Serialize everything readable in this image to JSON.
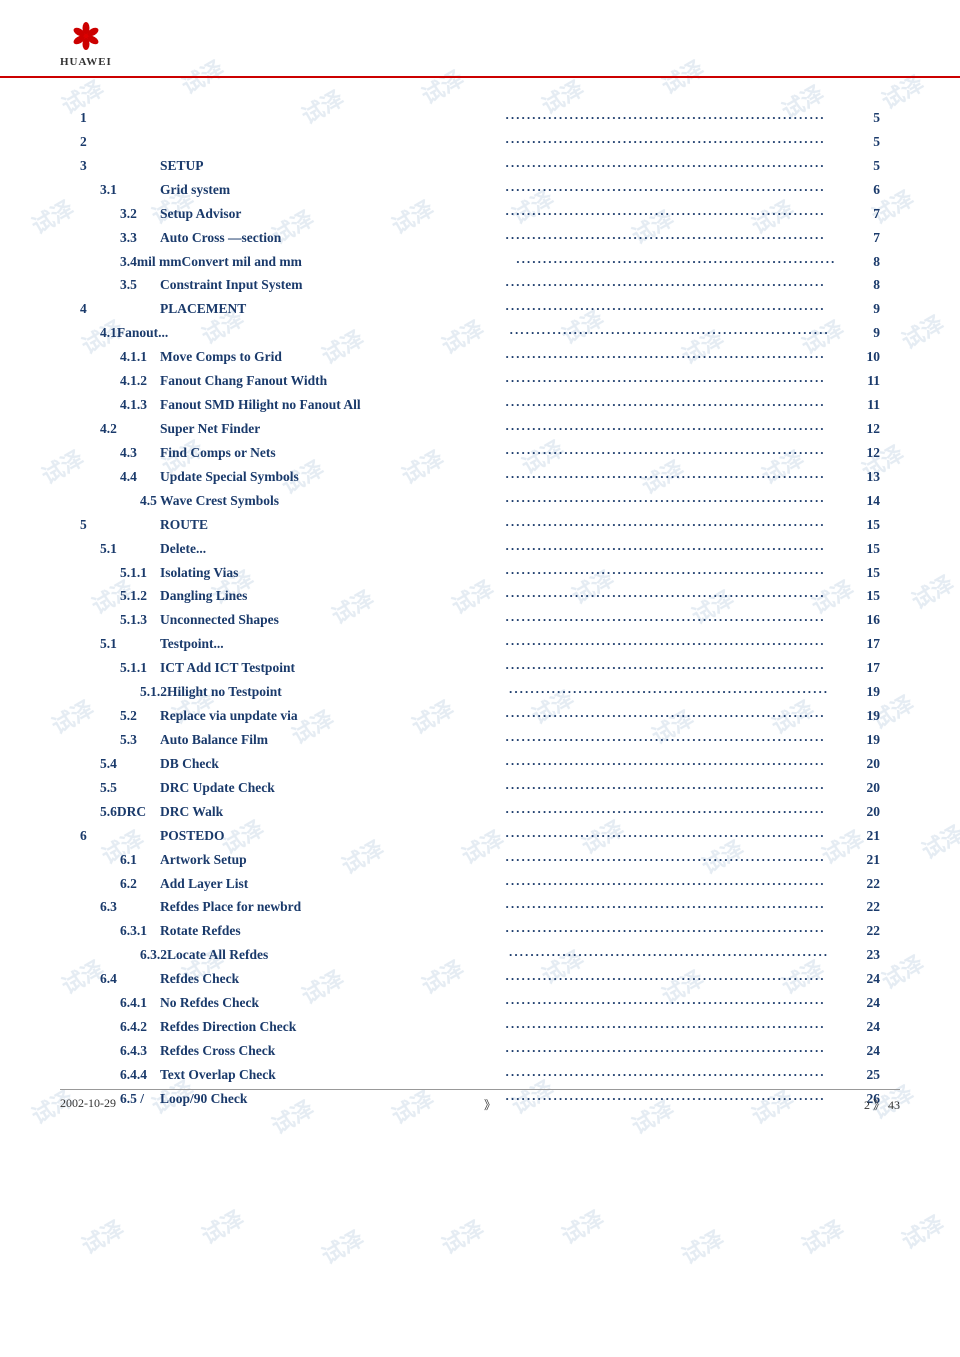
{
  "watermarks": [
    "试泽",
    "试泽",
    "试泽",
    "试泽",
    "试泽",
    "试泽",
    "试泽",
    "试泽",
    "试泽",
    "试泽",
    "试泽",
    "试泽",
    "试泽",
    "试泽",
    "试泽",
    "试泽",
    "试泽",
    "试泽",
    "试泽",
    "试泽",
    "试泽",
    "试泽",
    "试泽",
    "试泽",
    "试泽",
    "试泽",
    "试泽",
    "试泽",
    "试泽",
    "试泽"
  ],
  "logo": {
    "company": "HUAWEI"
  },
  "toc": [
    {
      "num": "1",
      "title": "",
      "dots": true,
      "page": "5",
      "indent": 0
    },
    {
      "num": "2",
      "title": "",
      "dots": true,
      "page": "5",
      "indent": 0
    },
    {
      "num": "3",
      "title": "SETUP",
      "dots": true,
      "page": "5",
      "indent": 0
    },
    {
      "num": "3.1",
      "title": "Grid system",
      "dots": true,
      "page": "6",
      "indent": 1
    },
    {
      "num": "3.2",
      "title": "Setup Advisor",
      "dots": true,
      "page": "7",
      "indent": 2
    },
    {
      "num": "3.3",
      "title": "Auto Cross —section",
      "dots": true,
      "page": "7",
      "indent": 2
    },
    {
      "num": "3.4mil  mm",
      "title": "Convert mil and mm",
      "dots": true,
      "page": "8",
      "indent": 2,
      "title_right": true
    },
    {
      "num": "3.5",
      "title": "Constraint Input System",
      "dots": true,
      "page": "8",
      "indent": 2
    },
    {
      "num": "4",
      "title": "PLACEMENT",
      "dots": true,
      "page": "9",
      "indent": 0
    },
    {
      "num": "4.1Fanout...",
      "title": "",
      "dots": true,
      "page": "9",
      "indent": 1
    },
    {
      "num": "4.1.1",
      "title": "Move Comps to Grid",
      "dots": true,
      "page": "10",
      "indent": 2
    },
    {
      "num": "4.1.2",
      "title": "Fanout    Chang Fanout Width",
      "dots": true,
      "page": "11",
      "indent": 2
    },
    {
      "num": "4.1.3",
      "title": "Fanout SMD Hilight no Fanout All",
      "dots": true,
      "page": "11",
      "indent": 2
    },
    {
      "num": "4.2",
      "title": "Super Net Finder",
      "dots": true,
      "page": "12",
      "indent": 1
    },
    {
      "num": "4.3",
      "title": "Find Comps or Nets",
      "dots": true,
      "page": "12",
      "indent": 2
    },
    {
      "num": "4.4",
      "title": "Update Special Symbols",
      "dots": true,
      "page": "13",
      "indent": 2
    },
    {
      "num": "4.5",
      "title": "Wave Crest Symbols",
      "dots": true,
      "page": "14",
      "indent": 3
    },
    {
      "num": "5",
      "title": "ROUTE",
      "dots": true,
      "page": "15",
      "indent": 0
    },
    {
      "num": "5.1",
      "title": "Delete...",
      "dots": true,
      "page": "15",
      "indent": 1
    },
    {
      "num": "5.1.1",
      "title": "Isolating Vias",
      "dots": true,
      "page": "15",
      "indent": 2
    },
    {
      "num": "5.1.2",
      "title": "Dangling Lines",
      "dots": true,
      "page": "15",
      "indent": 2
    },
    {
      "num": "5.1.3",
      "title": "Unconnected Shapes",
      "dots": true,
      "page": "16",
      "indent": 2
    },
    {
      "num": "5.1",
      "title": "Testpoint...",
      "dots": true,
      "page": "17",
      "indent": 1
    },
    {
      "num": "5.1.1",
      "title": "ICT    Add ICT Testpoint",
      "dots": true,
      "page": "17",
      "indent": 2
    },
    {
      "num": "5.1.2",
      "title": "Hilight no Testpoint",
      "dots": true,
      "page": "19",
      "indent": 3
    },
    {
      "num": "5.2",
      "title": "Replace via  unpdate via",
      "dots": true,
      "page": "19",
      "indent": 2
    },
    {
      "num": "5.3",
      "title": "Auto Balance Film",
      "dots": true,
      "page": "19",
      "indent": 2
    },
    {
      "num": "5.4",
      "title": "DB Check",
      "dots": true,
      "page": "20",
      "indent": 1
    },
    {
      "num": "5.5",
      "title": "DRC Update Check",
      "dots": true,
      "page": "20",
      "indent": 1
    },
    {
      "num": "5.6DRC",
      "title": "DRC Walk",
      "dots": true,
      "page": "20",
      "indent": 1
    },
    {
      "num": "6",
      "title": "POSTEDO",
      "dots": true,
      "page": "21",
      "indent": 0
    },
    {
      "num": "6.1",
      "title": "Artwork Setup",
      "dots": true,
      "page": "21",
      "indent": 2
    },
    {
      "num": "6.2",
      "title": "Add Layer List",
      "dots": true,
      "page": "22",
      "indent": 2
    },
    {
      "num": "6.3",
      "title": "Refdes Place for newbrd",
      "dots": true,
      "page": "22",
      "indent": 1
    },
    {
      "num": "6.3.1",
      "title": "Rotate Refdes",
      "dots": true,
      "page": "22",
      "indent": 2
    },
    {
      "num": "6.3.2",
      "title": "Locate All Refdes",
      "dots": true,
      "page": "23",
      "indent": 3
    },
    {
      "num": "6.4",
      "title": "Refdes Check",
      "dots": true,
      "page": "24",
      "indent": 1
    },
    {
      "num": "6.4.1",
      "title": "No Refdes Check",
      "dots": true,
      "page": "24",
      "indent": 2
    },
    {
      "num": "6.4.2",
      "title": "Refdes Direction  Check",
      "dots": true,
      "page": "24",
      "indent": 2
    },
    {
      "num": "6.4.3",
      "title": "Refdes Cross Check",
      "dots": true,
      "page": "24",
      "indent": 2
    },
    {
      "num": "6.4.4",
      "title": "Text Overlap Check",
      "dots": true,
      "page": "25",
      "indent": 2
    },
    {
      "num": "6.5   /",
      "title": "Loop/90 Check",
      "dots": true,
      "page": "26",
      "indent": 2
    }
  ],
  "footer": {
    "date": "2002-10-29",
    "center": "》",
    "right": "2  》  43"
  }
}
